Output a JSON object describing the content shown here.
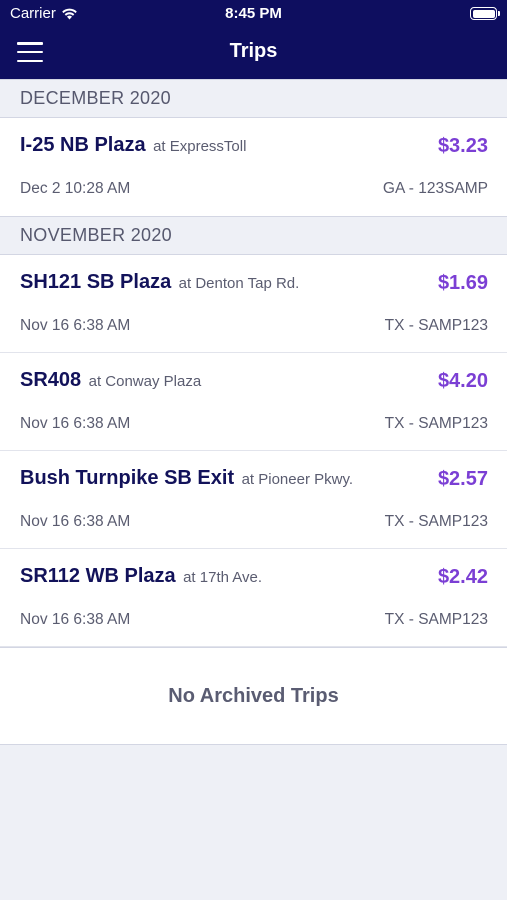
{
  "status_bar": {
    "carrier": "Carrier",
    "time": "8:45 PM",
    "wifi_icon": "wifi-icon",
    "battery_icon": "battery-icon"
  },
  "nav": {
    "title": "Trips",
    "menu_icon": "hamburger-menu-icon"
  },
  "sections": [
    {
      "label": "DECEMBER 2020",
      "trips": [
        {
          "plaza": "I-25 NB Plaza",
          "location": "at ExpressToll",
          "amount": "$3.23",
          "datetime": "Dec 2 10:28 AM",
          "plate": "GA - 123SAMP"
        }
      ]
    },
    {
      "label": "NOVEMBER 2020",
      "trips": [
        {
          "plaza": "SH121 SB Plaza",
          "location": "at Denton Tap Rd.",
          "amount": "$1.69",
          "datetime": "Nov 16 6:38 AM",
          "plate": "TX - SAMP123"
        },
        {
          "plaza": "SR408",
          "location": "at Conway Plaza",
          "amount": "$4.20",
          "datetime": "Nov 16 6:38 AM",
          "plate": "TX - SAMP123"
        },
        {
          "plaza": "Bush Turnpike SB Exit",
          "location": "at Pioneer Pkwy.",
          "amount": "$2.57",
          "datetime": "Nov 16 6:38 AM",
          "plate": "TX - SAMP123"
        },
        {
          "plaza": "SR112 WB Plaza",
          "location": "at 17th Ave.",
          "amount": "$2.42",
          "datetime": "Nov 16 6:38 AM",
          "plate": "TX - SAMP123"
        }
      ]
    }
  ],
  "archived_message": "No Archived Trips",
  "colors": {
    "header_bg": "#0e0e5f",
    "amount": "#7b3fd4",
    "plaza_name": "#12125a",
    "background": "#eef0f6"
  }
}
